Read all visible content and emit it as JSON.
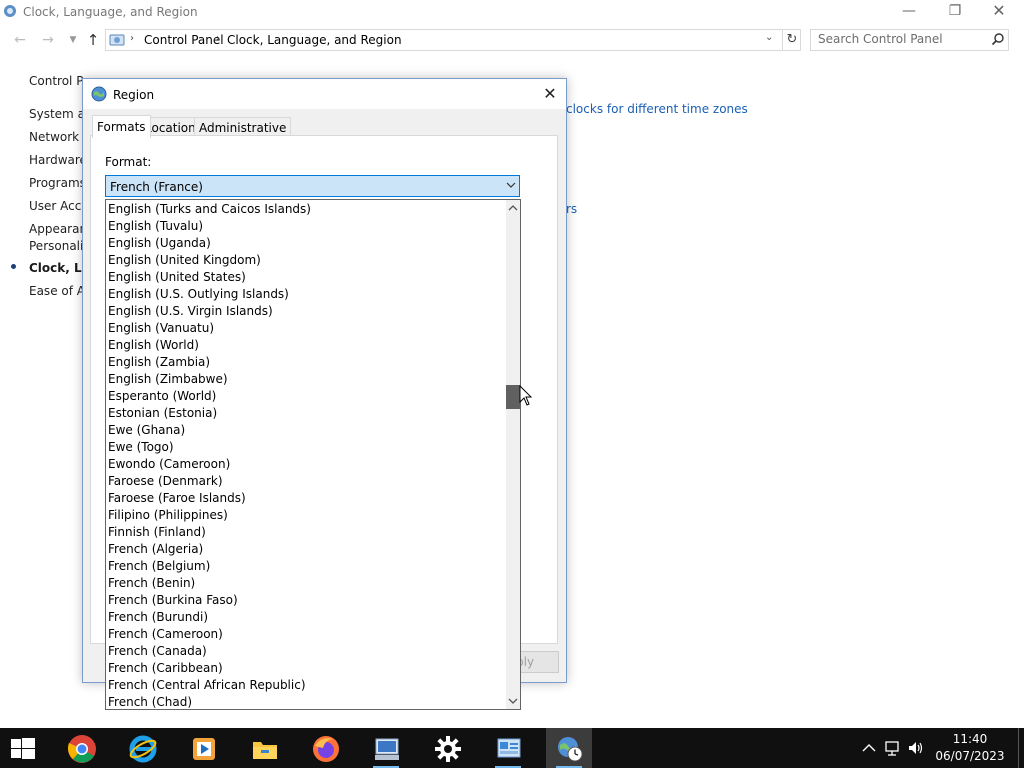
{
  "window": {
    "title": "Clock, Language, and Region",
    "address": {
      "crumbs": [
        "Control Panel",
        "Clock, Language, and Region"
      ]
    },
    "search_placeholder": "Search Control Panel"
  },
  "sidebar": {
    "items": [
      {
        "label": "Control Pa",
        "active": false
      },
      {
        "label": "System ar",
        "active": false
      },
      {
        "label": "Network",
        "active": false
      },
      {
        "label": "Hardware",
        "active": false
      },
      {
        "label": "Programs",
        "active": false
      },
      {
        "label": "User Acc",
        "active": false
      },
      {
        "label": "Appearan",
        "active": false
      },
      {
        "label": "Personaliz",
        "active": false
      },
      {
        "label": "Clock, La",
        "active": true
      },
      {
        "label": "Ease of A",
        "active": false
      }
    ]
  },
  "background_links": {
    "link1": "clocks for different time zones",
    "link2": "rs"
  },
  "dialog": {
    "title": "Region",
    "tabs": [
      "Formats",
      "Location",
      "Administrative"
    ],
    "active_tab": "Formats",
    "format_label": "Format:",
    "apply_label": "ply"
  },
  "format_combo": {
    "selected": "French (France)",
    "options": [
      "English (Turks and Caicos Islands)",
      "English (Tuvalu)",
      "English (Uganda)",
      "English (United Kingdom)",
      "English (United States)",
      "English (U.S. Outlying Islands)",
      "English (U.S. Virgin Islands)",
      "English (Vanuatu)",
      "English (World)",
      "English (Zambia)",
      "English (Zimbabwe)",
      "Esperanto (World)",
      "Estonian (Estonia)",
      "Ewe (Ghana)",
      "Ewe (Togo)",
      "Ewondo (Cameroon)",
      "Faroese (Denmark)",
      "Faroese (Faroe Islands)",
      "Filipino (Philippines)",
      "Finnish (Finland)",
      "French (Algeria)",
      "French (Belgium)",
      "French (Benin)",
      "French (Burkina Faso)",
      "French (Burundi)",
      "French (Cameroon)",
      "French (Canada)",
      "French (Caribbean)",
      "French (Central African Republic)",
      "French (Chad)"
    ]
  },
  "taskbar": {
    "apps": [
      "start-icon",
      "chrome-icon",
      "internet-explorer-icon",
      "media-player-icon",
      "file-explorer-icon",
      "firefox-icon",
      "remote-desktop-icon",
      "settings-icon",
      "control-panel-icon",
      "region-clock-icon"
    ],
    "clock": {
      "time": "11:40",
      "date": "06/07/2023"
    }
  },
  "colors": {
    "accent": "#0078d7",
    "combo_highlight": "#cce4f7",
    "link": "#1a5fb4",
    "taskbar": "#101010"
  }
}
